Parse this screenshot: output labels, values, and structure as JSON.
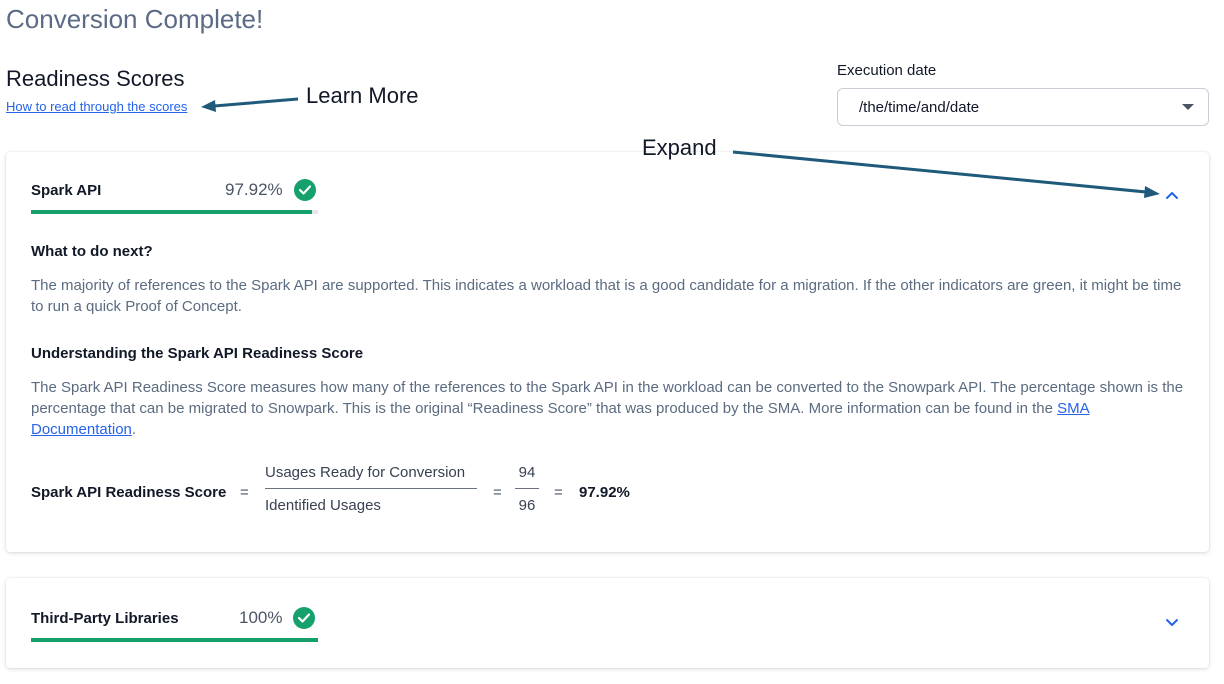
{
  "page_title": "Conversion Complete!",
  "readiness": {
    "title": "Readiness Scores",
    "help_link": "How to read through the scores"
  },
  "annotations": {
    "learn_more": "Learn More",
    "expand": "Expand"
  },
  "execution": {
    "label": "Execution date",
    "value": "/the/time/and/date"
  },
  "spark_card": {
    "name": "Spark API",
    "percent": "97.92%",
    "progress": 0.9792,
    "what_next_title": "What to do next?",
    "what_next_text": "The majority of references to the Spark API are supported. This indicates a workload that is a good candidate for a migration. If the other indicators are green, it might be time to run a quick Proof of Concept.",
    "understanding_title": "Understanding the Spark API Readiness Score",
    "understanding_text_before": "The Spark API Readiness Score measures how many of the references to the Spark API in the workload can be converted to the Snowpark API. The percentage shown is the percentage that can be migrated to Snowpark. This is the original “Readiness Score” that was produced by the SMA. More information can be found in the ",
    "understanding_link": "SMA Documentation",
    "understanding_text_after": ".",
    "formula": {
      "label": "Spark API Readiness Score",
      "eq": "=",
      "numerator_label": "Usages Ready for Conversion",
      "denominator_label": "Identified Usages",
      "numerator_value": "94",
      "denominator_value": "96",
      "result": "97.92%"
    },
    "chevron": "chevron-up-icon"
  },
  "third_card": {
    "name": "Third-Party Libraries",
    "percent": "100%",
    "progress": 1.0,
    "chevron": "chevron-down-icon"
  },
  "colors": {
    "accent": "#2563eb",
    "success": "#16a06b",
    "annotation_arrow": "#1f5a7a"
  }
}
